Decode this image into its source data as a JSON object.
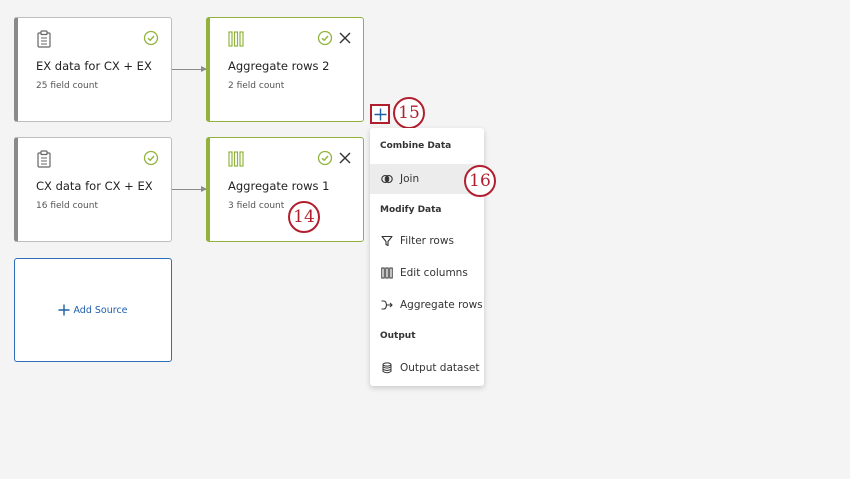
{
  "sources": [
    {
      "title": "EX data for CX + EX",
      "subtitle": "25 field count"
    },
    {
      "title": "CX data for CX + EX",
      "subtitle": "16 field count"
    }
  ],
  "aggregates": [
    {
      "title": "Aggregate rows 2",
      "subtitle": "2 field count"
    },
    {
      "title": "Aggregate rows 1",
      "subtitle": "3 field count"
    }
  ],
  "add_source": {
    "label": "Add Source"
  },
  "badges": {
    "b14": "14",
    "b15": "15",
    "b16": "16"
  },
  "menu": {
    "combine_heading": "Combine Data",
    "join": "Join",
    "modify_heading": "Modify Data",
    "filter_rows": "Filter rows",
    "edit_columns": "Edit columns",
    "aggregate_rows": "Aggregate rows",
    "output_heading": "Output",
    "output_dataset": "Output dataset"
  },
  "colors": {
    "success_green": "#91b33d",
    "accent_blue": "#1f5fa8",
    "callout_red": "#b11f2e"
  }
}
